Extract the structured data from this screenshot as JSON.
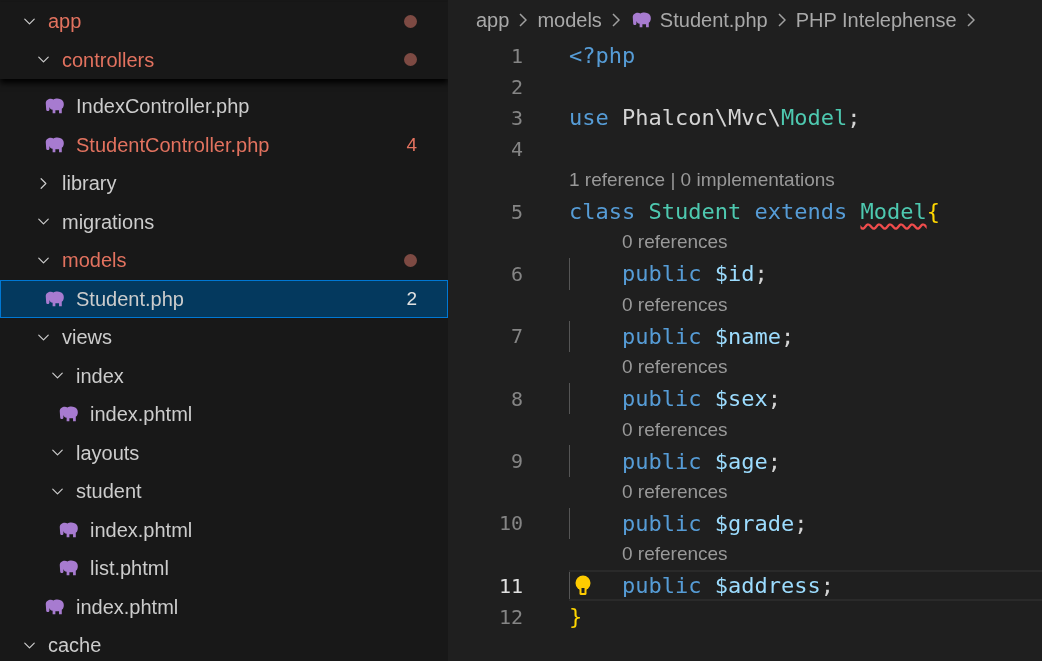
{
  "explorer": {
    "tree": [
      {
        "name": "app",
        "kind": "folder",
        "expanded": true,
        "modified": true,
        "children": [
          {
            "name": "controllers",
            "kind": "folder",
            "expanded": true,
            "modified": true,
            "children": [
              {
                "name": "IndexController.php",
                "kind": "file",
                "modified": false,
                "selected": false
              },
              {
                "name": "StudentController.php",
                "kind": "file",
                "modified": true,
                "badge": "4",
                "selected": false
              }
            ]
          },
          {
            "name": "library",
            "kind": "folder",
            "expanded": false,
            "modified": false
          },
          {
            "name": "migrations",
            "kind": "folder",
            "expanded": true,
            "modified": false
          },
          {
            "name": "models",
            "kind": "folder",
            "expanded": true,
            "modified": true,
            "children": [
              {
                "name": "Student.php",
                "kind": "file",
                "modified": false,
                "badge": "2",
                "selected": true
              }
            ]
          },
          {
            "name": "views",
            "kind": "folder",
            "expanded": true,
            "modified": false,
            "children": [
              {
                "name": "index",
                "kind": "folder",
                "expanded": true,
                "modified": false,
                "children": [
                  {
                    "name": "index.phtml",
                    "kind": "file",
                    "modified": false,
                    "selected": false
                  }
                ]
              },
              {
                "name": "layouts",
                "kind": "folder",
                "expanded": true,
                "modified": false
              },
              {
                "name": "student",
                "kind": "folder",
                "expanded": true,
                "modified": false,
                "children": [
                  {
                    "name": "index.phtml",
                    "kind": "file",
                    "modified": false,
                    "selected": false
                  },
                  {
                    "name": "list.phtml",
                    "kind": "file",
                    "modified": false,
                    "selected": false
                  }
                ]
              },
              {
                "name": "index.phtml",
                "kind": "file",
                "modified": false,
                "selected": false
              }
            ]
          }
        ]
      },
      {
        "name": "cache",
        "kind": "folder",
        "expanded": true,
        "modified": false
      }
    ]
  },
  "editor": {
    "breadcrumbs": [
      {
        "text": "app",
        "kind": "folder"
      },
      {
        "text": "models",
        "kind": "folder"
      },
      {
        "text": "Student.php",
        "kind": "file"
      },
      {
        "text": "PHP Intelephense",
        "kind": "symbol"
      }
    ],
    "lines": [
      {
        "number": "1",
        "tokens": [
          {
            "text": "<?php",
            "kind": "tag"
          }
        ]
      },
      {
        "number": "2"
      },
      {
        "number": "3",
        "tokens": [
          {
            "text": "use ",
            "kind": "keyword"
          },
          {
            "text": "Phalcon\\Mvc\\",
            "kind": "plain"
          },
          {
            "text": "Model",
            "kind": "type"
          },
          {
            "text": ";",
            "kind": "plain"
          }
        ]
      },
      {
        "number": "4"
      },
      {
        "number": "5",
        "lens": "1 reference | 0 implementations",
        "tokens": [
          {
            "text": "class ",
            "kind": "keyword"
          },
          {
            "text": "Student ",
            "kind": "type"
          },
          {
            "text": "extends ",
            "kind": "keyword"
          },
          {
            "text": "Model",
            "kind": "type",
            "error": true
          },
          {
            "text": "{",
            "kind": "brace"
          }
        ]
      },
      {
        "number": "6",
        "indented": true,
        "lens": "0 references",
        "tokens": [
          {
            "text": "public ",
            "kind": "keyword"
          },
          {
            "text": "$id",
            "kind": "variable"
          },
          {
            "text": ";",
            "kind": "plain"
          }
        ]
      },
      {
        "number": "7",
        "indented": true,
        "lens": "0 references",
        "tokens": [
          {
            "text": "public ",
            "kind": "keyword"
          },
          {
            "text": "$name",
            "kind": "variable"
          },
          {
            "text": ";",
            "kind": "plain"
          }
        ]
      },
      {
        "number": "8",
        "indented": true,
        "lens": "0 references",
        "tokens": [
          {
            "text": "public ",
            "kind": "keyword"
          },
          {
            "text": "$sex",
            "kind": "variable"
          },
          {
            "text": ";",
            "kind": "plain"
          }
        ]
      },
      {
        "number": "9",
        "indented": true,
        "lens": "0 references",
        "tokens": [
          {
            "text": "public ",
            "kind": "keyword"
          },
          {
            "text": "$age",
            "kind": "variable"
          },
          {
            "text": ";",
            "kind": "plain"
          }
        ]
      },
      {
        "number": "10",
        "indented": true,
        "lens": "0 references",
        "tokens": [
          {
            "text": "public ",
            "kind": "keyword"
          },
          {
            "text": "$grade",
            "kind": "variable"
          },
          {
            "text": ";",
            "kind": "plain"
          }
        ]
      },
      {
        "number": "11",
        "indented": true,
        "current": true,
        "lens": "0 references",
        "tokens": [
          {
            "text": "public ",
            "kind": "keyword"
          },
          {
            "text": "$address",
            "kind": "variable"
          },
          {
            "text": ";",
            "kind": "plain"
          }
        ]
      },
      {
        "number": "12",
        "tokens": [
          {
            "text": "}",
            "kind": "brace"
          }
        ]
      }
    ]
  }
}
